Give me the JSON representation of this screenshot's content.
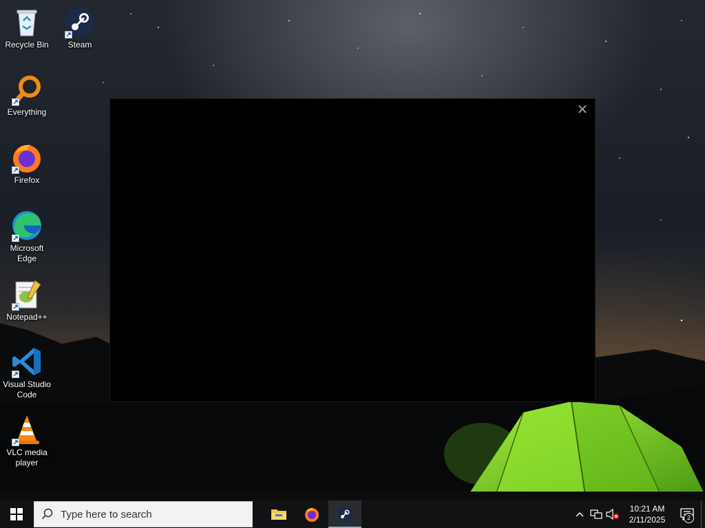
{
  "desktop": {
    "icons": [
      {
        "label": "Recycle Bin",
        "icon": "recycle-bin-icon"
      },
      {
        "label": "Steam",
        "icon": "steam-icon"
      },
      {
        "label": "Everything",
        "icon": "everything-search-icon"
      },
      {
        "label": "Firefox",
        "icon": "firefox-icon"
      },
      {
        "label": "Microsoft Edge",
        "icon": "edge-icon"
      },
      {
        "label": "Notepad++",
        "icon": "notepad-plus-plus-icon"
      },
      {
        "label": "Visual Studio Code",
        "icon": "vscode-icon"
      },
      {
        "label": "VLC media player",
        "icon": "vlc-icon"
      }
    ]
  },
  "overlay": {
    "close_glyph": "✕"
  },
  "taskbar": {
    "search_placeholder": "Type here to search",
    "pinned": [
      {
        "name": "File Explorer",
        "icon": "file-explorer-icon"
      },
      {
        "name": "Firefox",
        "icon": "firefox-icon"
      },
      {
        "name": "Steam",
        "icon": "steam-icon",
        "active": true
      }
    ],
    "tray": {
      "time": "10:21 AM",
      "date": "2/11/2025",
      "notification_count": "2"
    }
  },
  "colors": {
    "taskbar": "#111214",
    "accent": "#76b9ed",
    "tent_green": "#7ed321"
  }
}
